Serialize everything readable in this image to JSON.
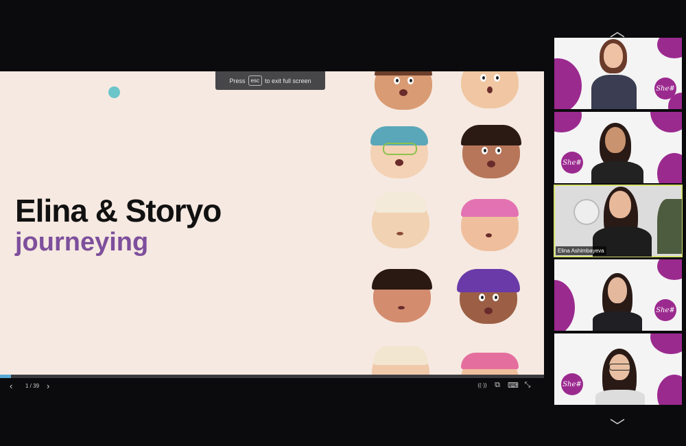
{
  "slide": {
    "title": "Elina & Storyo",
    "subtitle": "journeying",
    "progress_fraction": 0.02
  },
  "fullscreen_hint": {
    "press": "Press",
    "key": "esc",
    "suffix": "to exit full screen"
  },
  "controls": {
    "prev_icon": "‹",
    "next_icon": "›",
    "page": "1 / 39",
    "broadcast_icon": "((·))",
    "window_icon": "⧉",
    "keyboard_icon": "⌨",
    "exit_fullscreen_icon": "⤡"
  },
  "participants": {
    "scroll_up_icon": "︿",
    "scroll_down_icon": "﹀",
    "logo_text": "She#",
    "tiles": [
      {
        "name": ""
      },
      {
        "name": ""
      },
      {
        "name": "Elina Ashimbayeva"
      },
      {
        "name": ""
      },
      {
        "name": ""
      }
    ]
  },
  "colors": {
    "slide_bg": "#f6e9e1",
    "accent_purple": "#7d4f9c",
    "brand_magenta": "#9b2a8f",
    "active_speaker": "#d7e16d"
  }
}
